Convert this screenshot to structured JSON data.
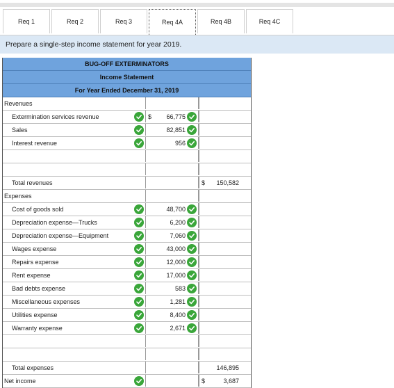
{
  "tabs": [
    "Req 1",
    "Req 2",
    "Req 3",
    "Req 4A",
    "Req 4B",
    "Req 4C"
  ],
  "active_tab": "Req 4A",
  "instruction": "Prepare a single-step income statement for year 2019.",
  "statement": {
    "company": "BUG-OFF EXTERMINATORS",
    "title": "Income Statement",
    "period": "For Year Ended December 31, 2019"
  },
  "rows": [
    {
      "label": "Revenues",
      "indent": false,
      "check": false,
      "c1": "",
      "c1_cur": "",
      "c1_check": false,
      "c2": "",
      "c2_cur": ""
    },
    {
      "label": "Extermination services revenue",
      "indent": true,
      "check": true,
      "c1": "66,775",
      "c1_cur": "$",
      "c1_check": true,
      "c2": "",
      "c2_cur": ""
    },
    {
      "label": "Sales",
      "indent": true,
      "check": true,
      "c1": "82,851",
      "c1_cur": "",
      "c1_check": true,
      "c2": "",
      "c2_cur": ""
    },
    {
      "label": "Interest revenue",
      "indent": true,
      "check": true,
      "c1": "956",
      "c1_cur": "",
      "c1_check": true,
      "c2": "",
      "c2_cur": ""
    },
    {
      "label": "",
      "indent": true,
      "check": false,
      "c1": "",
      "c1_cur": "",
      "c1_check": false,
      "c2": "",
      "c2_cur": ""
    },
    {
      "label": "",
      "indent": true,
      "check": false,
      "c1": "",
      "c1_cur": "",
      "c1_check": false,
      "c2": "",
      "c2_cur": ""
    },
    {
      "label": "Total revenues",
      "indent": true,
      "check": false,
      "c1": "",
      "c1_cur": "",
      "c1_check": false,
      "c2": "150,582",
      "c2_cur": "$"
    },
    {
      "label": "Expenses",
      "indent": false,
      "check": false,
      "c1": "",
      "c1_cur": "",
      "c1_check": false,
      "c2": "",
      "c2_cur": ""
    },
    {
      "label": "Cost of goods sold",
      "indent": true,
      "check": true,
      "c1": "48,700",
      "c1_cur": "",
      "c1_check": true,
      "c2": "",
      "c2_cur": ""
    },
    {
      "label": "Depreciation expense—Trucks",
      "indent": true,
      "check": true,
      "c1": "6,200",
      "c1_cur": "",
      "c1_check": true,
      "c2": "",
      "c2_cur": ""
    },
    {
      "label": "Depreciation expense—Equipment",
      "indent": true,
      "check": true,
      "c1": "7,060",
      "c1_cur": "",
      "c1_check": true,
      "c2": "",
      "c2_cur": ""
    },
    {
      "label": "Wages expense",
      "indent": true,
      "check": true,
      "c1": "43,000",
      "c1_cur": "",
      "c1_check": true,
      "c2": "",
      "c2_cur": ""
    },
    {
      "label": "Repairs expense",
      "indent": true,
      "check": true,
      "c1": "12,000",
      "c1_cur": "",
      "c1_check": true,
      "c2": "",
      "c2_cur": ""
    },
    {
      "label": "Rent expense",
      "indent": true,
      "check": true,
      "c1": "17,000",
      "c1_cur": "",
      "c1_check": true,
      "c2": "",
      "c2_cur": ""
    },
    {
      "label": "Bad debts expense",
      "indent": true,
      "check": true,
      "c1": "583",
      "c1_cur": "",
      "c1_check": true,
      "c2": "",
      "c2_cur": ""
    },
    {
      "label": "Miscellaneous expenses",
      "indent": true,
      "check": true,
      "c1": "1,281",
      "c1_cur": "",
      "c1_check": true,
      "c2": "",
      "c2_cur": ""
    },
    {
      "label": "Utilities expense",
      "indent": true,
      "check": true,
      "c1": "8,400",
      "c1_cur": "",
      "c1_check": true,
      "c2": "",
      "c2_cur": ""
    },
    {
      "label": "Warranty expense",
      "indent": true,
      "check": true,
      "c1": "2,671",
      "c1_cur": "",
      "c1_check": true,
      "c2": "",
      "c2_cur": ""
    },
    {
      "label": "",
      "indent": true,
      "check": false,
      "c1": "",
      "c1_cur": "",
      "c1_check": false,
      "c2": "",
      "c2_cur": ""
    },
    {
      "label": "",
      "indent": true,
      "check": false,
      "c1": "",
      "c1_cur": "",
      "c1_check": false,
      "c2": "",
      "c2_cur": ""
    },
    {
      "label": "Total expenses",
      "indent": true,
      "check": false,
      "c1": "",
      "c1_cur": "",
      "c1_check": false,
      "c2": "146,895",
      "c2_cur": ""
    },
    {
      "label": "Net income",
      "indent": false,
      "check": true,
      "c1": "",
      "c1_cur": "",
      "c1_check": false,
      "c2": "3,687",
      "c2_cur": "$"
    }
  ],
  "icons": {
    "check": "check-circle-icon"
  },
  "colors": {
    "check_green": "#3aa63a",
    "header_blue": "#6fa3dd",
    "instruction_bg": "#dbe8f5"
  }
}
